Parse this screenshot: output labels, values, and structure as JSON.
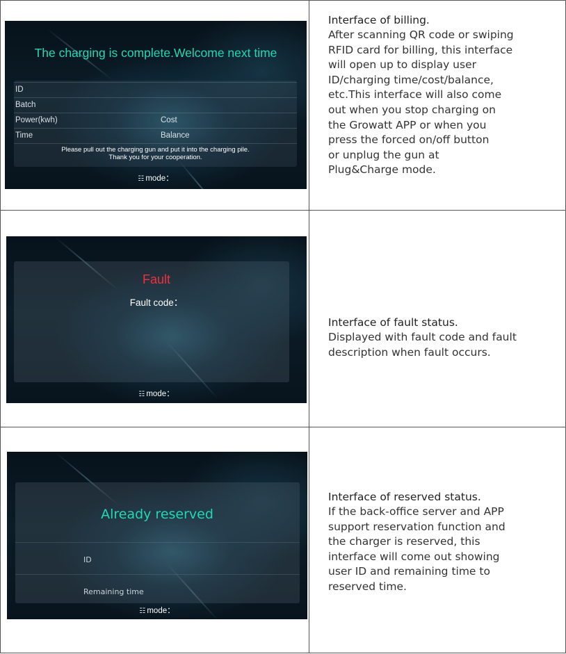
{
  "billing": {
    "screen_title": "The charging is complete.Welcome next time",
    "rows": [
      {
        "left": "ID",
        "right": ""
      },
      {
        "left": "Batch",
        "right": ""
      },
      {
        "left": "Power(kwh)",
        "right": "Cost"
      },
      {
        "left": "Time",
        "right": "Balance"
      }
    ],
    "note_line1": "Please pull out the charging gun and put it into the charging pile.",
    "note_line2": "Thank you for your cooperation.",
    "mode_label": "mode：",
    "heading": "Interface of billing.",
    "body_lines": [
      "After scanning QR code or swiping",
      "RFID card for billing, this interface",
      "will open up to display user",
      "ID/charging time/cost/balance,",
      "etc.This interface will also come",
      "out when you stop charging on",
      "the Growatt APP or when you",
      "press the forced on/off button",
      "or unplug the gun at",
      "Plug&Charge mode."
    ]
  },
  "fault": {
    "screen_title": "Fault",
    "code_label": "Fault code：",
    "mode_label": "mode：",
    "heading": "Interface of fault status.",
    "body_lines": [
      "Displayed with fault code and fault",
      "description when fault occurs."
    ]
  },
  "reserved": {
    "screen_title": "Already reserved",
    "rows": [
      "ID",
      "Remaining time"
    ],
    "mode_label": "mode：",
    "heading": "Interface of reserved status.",
    "body_lines": [
      "If the back-office server and APP",
      "support reservation function and",
      "the charger is reserved, this",
      "interface will come out showing",
      "user ID and remaining time to",
      "reserved time."
    ]
  },
  "icons": {
    "mode": "settings-sliders-icon"
  }
}
